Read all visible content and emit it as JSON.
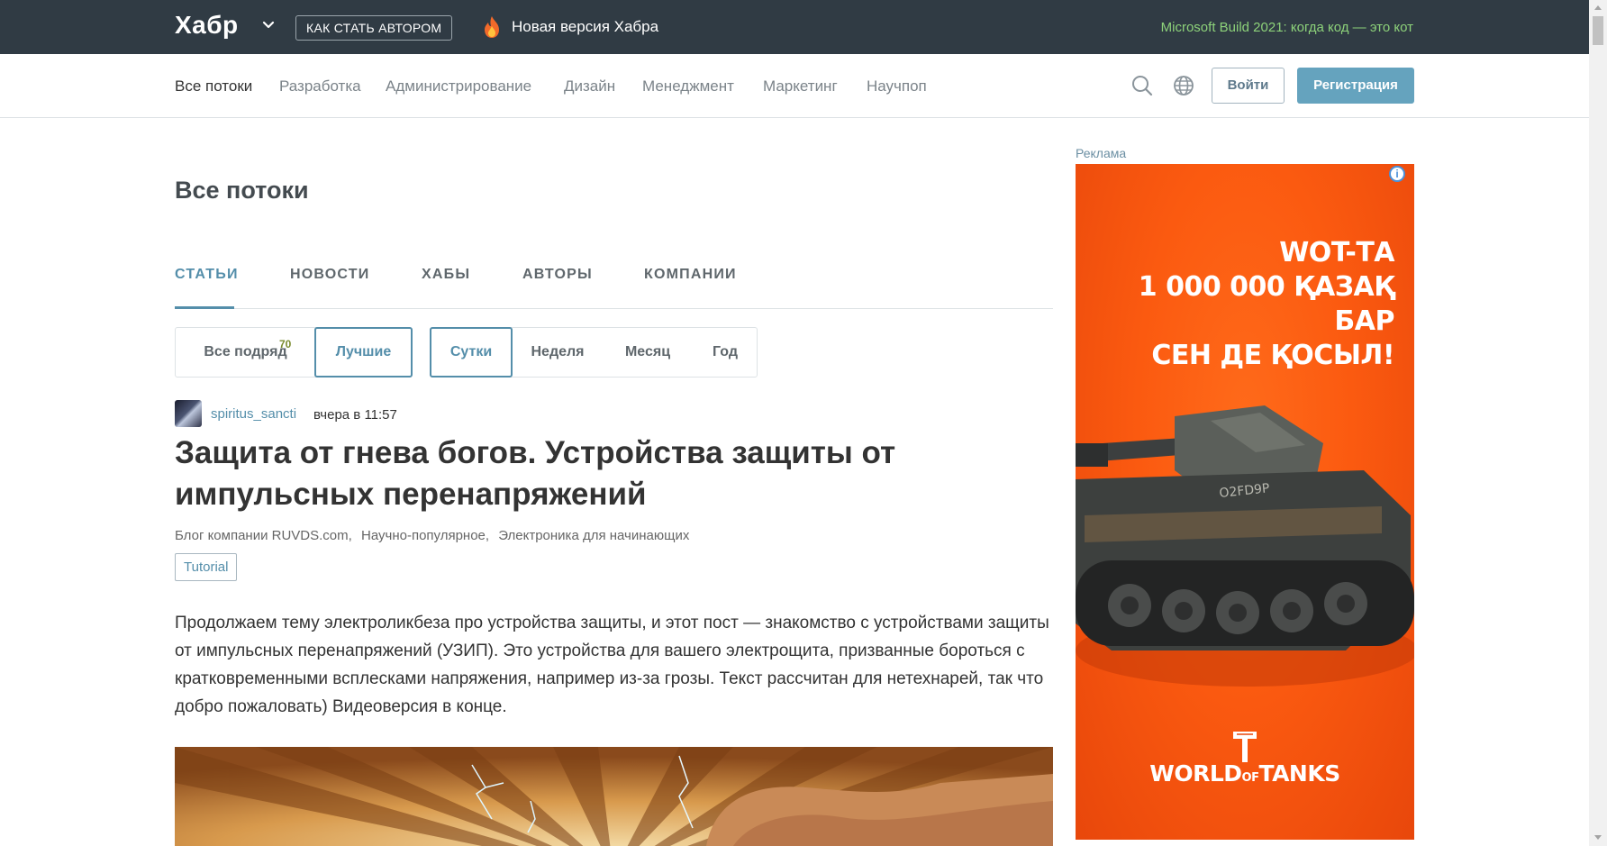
{
  "header": {
    "logo": "Хабр",
    "become_author": "КАК СТАТЬ АВТОРОМ",
    "new_version": "Новая версия Хабра",
    "promo": "Microsoft Build 2021: когда код — это кот"
  },
  "nav": {
    "items": [
      "Все потоки",
      "Разработка",
      "Администрирование",
      "Дизайн",
      "Менеджмент",
      "Маркетинг",
      "Научпоп"
    ],
    "login": "Войти",
    "register": "Регистрация"
  },
  "main": {
    "page_title": "Все потоки",
    "tabs": [
      "СТАТЬИ",
      "НОВОСТИ",
      "ХАБЫ",
      "АВТОРЫ",
      "КОМПАНИИ"
    ],
    "filters": {
      "all": "Все подряд",
      "all_count": "70",
      "best": "Лучшие",
      "periods": [
        "Сутки",
        "Неделя",
        "Месяц",
        "Год"
      ]
    }
  },
  "article": {
    "author": "spiritus_sancti",
    "time": "вчера в 11:57",
    "title": "Защита от гнева богов. Устройства защиты от импульсных перенапряжений",
    "hubs": [
      "Блог компании RUVDS.com,",
      "Научно-популярное,",
      "Электроника для начинающих"
    ],
    "badge": "Tutorial",
    "excerpt": "Продолжаем тему электроликбеза про устройства защиты, и этот пост — знакомство с устройствами защиты от импульсных перенапряжений (УЗИП). Это устройства для вашего электрощита, призванные бороться с кратковременными всплесками напряжения, например из-за грозы. Текст рассчитан для нетехнарей, так что добро пожаловать) Видеоверсия в конце."
  },
  "sidebar": {
    "ad_label": "Реклама",
    "ad_headline": [
      "WOT-ТА",
      "1 000 000 ҚАЗАҚ БАР",
      "СЕН ДЕ ҚОСЫЛ!"
    ],
    "ad_tank_marking": "O2FD9P",
    "ad_brand": {
      "world": "WORLD",
      "of": "OF",
      "tanks": "TANKS"
    }
  }
}
